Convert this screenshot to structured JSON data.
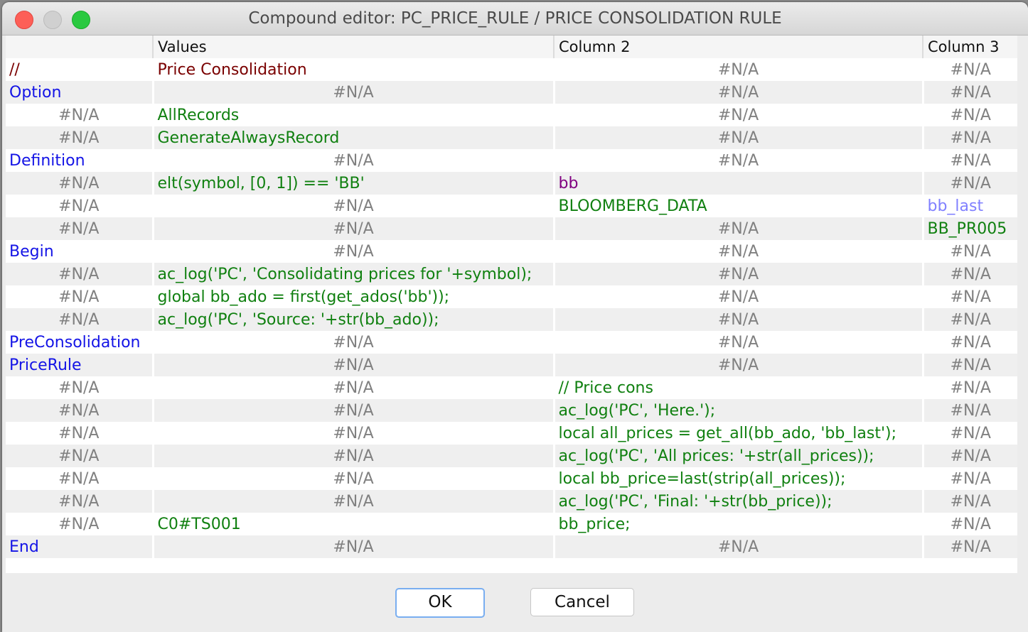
{
  "window": {
    "title": "Compound editor: PC_PRICE_RULE / PRICE CONSOLIDATION RULE",
    "controls": [
      "close",
      "minimize",
      "maximize"
    ]
  },
  "table": {
    "columns": [
      "",
      "Values",
      "Column 2",
      "Column 3"
    ],
    "rows": [
      {
        "cells": [
          {
            "text": "//",
            "style": "comment"
          },
          {
            "text": "Price Consolidation",
            "style": "comment"
          },
          {
            "text": "#N/A",
            "style": "na"
          },
          {
            "text": "#N/A",
            "style": "na"
          }
        ]
      },
      {
        "cells": [
          {
            "text": "Option",
            "style": "kw"
          },
          {
            "text": "#N/A",
            "style": "na"
          },
          {
            "text": "#N/A",
            "style": "na"
          },
          {
            "text": "#N/A",
            "style": "na"
          }
        ]
      },
      {
        "cells": [
          {
            "text": "#N/A",
            "style": "na"
          },
          {
            "text": "AllRecords",
            "style": "code"
          },
          {
            "text": "#N/A",
            "style": "na"
          },
          {
            "text": "#N/A",
            "style": "na"
          }
        ]
      },
      {
        "cells": [
          {
            "text": "#N/A",
            "style": "na"
          },
          {
            "text": "GenerateAlwaysRecord",
            "style": "code"
          },
          {
            "text": "#N/A",
            "style": "na"
          },
          {
            "text": "#N/A",
            "style": "na"
          }
        ]
      },
      {
        "cells": [
          {
            "text": "Definition",
            "style": "kw"
          },
          {
            "text": "#N/A",
            "style": "na"
          },
          {
            "text": "#N/A",
            "style": "na"
          },
          {
            "text": "#N/A",
            "style": "na"
          }
        ]
      },
      {
        "cells": [
          {
            "text": "#N/A",
            "style": "na"
          },
          {
            "text": "elt(symbol, [0, 1]) == 'BB'",
            "style": "code"
          },
          {
            "text": "bb",
            "style": "purple"
          },
          {
            "text": "#N/A",
            "style": "na"
          }
        ]
      },
      {
        "cells": [
          {
            "text": "#N/A",
            "style": "na"
          },
          {
            "text": "#N/A",
            "style": "na"
          },
          {
            "text": "BLOOMBERG_DATA",
            "style": "code"
          },
          {
            "text": "bb_last",
            "style": "lightblue"
          }
        ]
      },
      {
        "cells": [
          {
            "text": "#N/A",
            "style": "na"
          },
          {
            "text": "#N/A",
            "style": "na"
          },
          {
            "text": "#N/A",
            "style": "na"
          },
          {
            "text": "BB_PR005",
            "style": "code"
          }
        ]
      },
      {
        "cells": [
          {
            "text": "Begin",
            "style": "kw"
          },
          {
            "text": "#N/A",
            "style": "na"
          },
          {
            "text": "#N/A",
            "style": "na"
          },
          {
            "text": "#N/A",
            "style": "na"
          }
        ]
      },
      {
        "cells": [
          {
            "text": "#N/A",
            "style": "na"
          },
          {
            "text": "ac_log('PC', 'Consolidating prices for '+symbol);",
            "style": "code"
          },
          {
            "text": "#N/A",
            "style": "na"
          },
          {
            "text": "#N/A",
            "style": "na"
          }
        ]
      },
      {
        "cells": [
          {
            "text": "#N/A",
            "style": "na"
          },
          {
            "text": "global bb_ado = first(get_ados('bb'));",
            "style": "code"
          },
          {
            "text": "#N/A",
            "style": "na"
          },
          {
            "text": "#N/A",
            "style": "na"
          }
        ]
      },
      {
        "cells": [
          {
            "text": "#N/A",
            "style": "na"
          },
          {
            "text": "ac_log('PC', 'Source:  '+str(bb_ado));",
            "style": "code"
          },
          {
            "text": "#N/A",
            "style": "na"
          },
          {
            "text": "#N/A",
            "style": "na"
          }
        ]
      },
      {
        "cells": [
          {
            "text": "PreConsolidation",
            "style": "kw"
          },
          {
            "text": "#N/A",
            "style": "na"
          },
          {
            "text": "#N/A",
            "style": "na"
          },
          {
            "text": "#N/A",
            "style": "na"
          }
        ]
      },
      {
        "cells": [
          {
            "text": "PriceRule",
            "style": "kw"
          },
          {
            "text": "#N/A",
            "style": "na"
          },
          {
            "text": "#N/A",
            "style": "na"
          },
          {
            "text": "#N/A",
            "style": "na"
          }
        ]
      },
      {
        "cells": [
          {
            "text": "#N/A",
            "style": "na"
          },
          {
            "text": "#N/A",
            "style": "na"
          },
          {
            "text": "// Price cons",
            "style": "code"
          },
          {
            "text": "#N/A",
            "style": "na"
          }
        ]
      },
      {
        "cells": [
          {
            "text": "#N/A",
            "style": "na"
          },
          {
            "text": "#N/A",
            "style": "na"
          },
          {
            "text": "ac_log('PC', 'Here.');",
            "style": "code"
          },
          {
            "text": "#N/A",
            "style": "na"
          }
        ]
      },
      {
        "cells": [
          {
            "text": "#N/A",
            "style": "na"
          },
          {
            "text": "#N/A",
            "style": "na"
          },
          {
            "text": "local all_prices = get_all(bb_ado, 'bb_last');",
            "style": "code"
          },
          {
            "text": "#N/A",
            "style": "na"
          }
        ]
      },
      {
        "cells": [
          {
            "text": "#N/A",
            "style": "na"
          },
          {
            "text": "#N/A",
            "style": "na"
          },
          {
            "text": "ac_log('PC', 'All prices:  '+str(all_prices));",
            "style": "code"
          },
          {
            "text": "#N/A",
            "style": "na"
          }
        ]
      },
      {
        "cells": [
          {
            "text": "#N/A",
            "style": "na"
          },
          {
            "text": "#N/A",
            "style": "na"
          },
          {
            "text": "local bb_price=last(strip(all_prices));",
            "style": "code"
          },
          {
            "text": "#N/A",
            "style": "na"
          }
        ]
      },
      {
        "cells": [
          {
            "text": "#N/A",
            "style": "na"
          },
          {
            "text": "#N/A",
            "style": "na"
          },
          {
            "text": "ac_log('PC', 'Final:  '+str(bb_price));",
            "style": "code"
          },
          {
            "text": "#N/A",
            "style": "na"
          }
        ]
      },
      {
        "cells": [
          {
            "text": "#N/A",
            "style": "na"
          },
          {
            "text": "C0#TS001",
            "style": "code"
          },
          {
            "text": "bb_price;",
            "style": "code"
          },
          {
            "text": "#N/A",
            "style": "na"
          }
        ]
      },
      {
        "cells": [
          {
            "text": "End",
            "style": "kw"
          },
          {
            "text": "#N/A",
            "style": "na"
          },
          {
            "text": "#N/A",
            "style": "na"
          },
          {
            "text": "#N/A",
            "style": "na"
          }
        ]
      }
    ]
  },
  "buttons": {
    "ok": "OK",
    "cancel": "Cancel"
  },
  "colors": {
    "keyword": "#1414e6",
    "comment": "#7a0000",
    "code": "#108010",
    "na": "#808080",
    "purple": "#800080",
    "lightblue": "#8080ff",
    "focus_ring": "#79aef0"
  }
}
